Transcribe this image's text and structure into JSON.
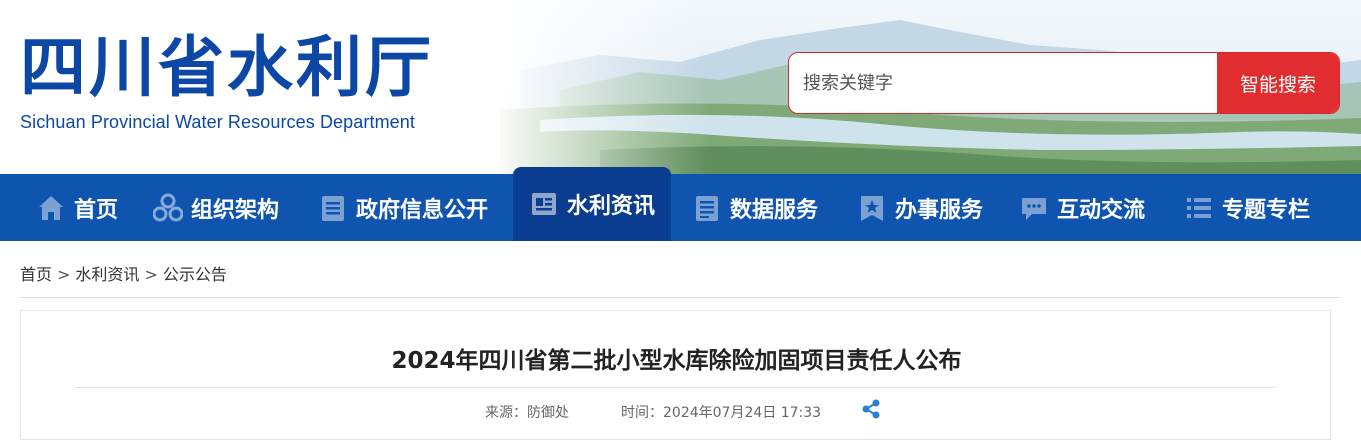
{
  "header": {
    "logo_cn": "四川省水利厅",
    "logo_en": "Sichuan Provincial Water Resources Department"
  },
  "search": {
    "placeholder": "搜索关键字",
    "button_label": "智能搜索"
  },
  "nav": {
    "items": [
      {
        "label": "首页",
        "icon": "home-icon"
      },
      {
        "label": "组织架构",
        "icon": "org-icon"
      },
      {
        "label": "政府信息公开",
        "icon": "document-list-icon"
      },
      {
        "label": "水利资讯",
        "icon": "news-icon",
        "active": true
      },
      {
        "label": "数据服务",
        "icon": "data-icon"
      },
      {
        "label": "办事服务",
        "icon": "star-badge-icon"
      },
      {
        "label": "互动交流",
        "icon": "chat-icon"
      },
      {
        "label": "专题专栏",
        "icon": "list-icon"
      }
    ]
  },
  "breadcrumb": {
    "items": [
      "首页",
      "水利资讯",
      "公示公告"
    ],
    "separator": ">"
  },
  "article": {
    "title": "2024年四川省第二批小型水库除险加固项目责任人公布",
    "source": "来源：防御处",
    "time": "时间：2024年07月24日 17:33"
  },
  "colors": {
    "brand_blue": "#0d47a6",
    "nav_blue": "#0f55b0",
    "nav_active": "#0a3c8f",
    "search_red": "#e12d30",
    "share_blue": "#2a7fd4"
  }
}
